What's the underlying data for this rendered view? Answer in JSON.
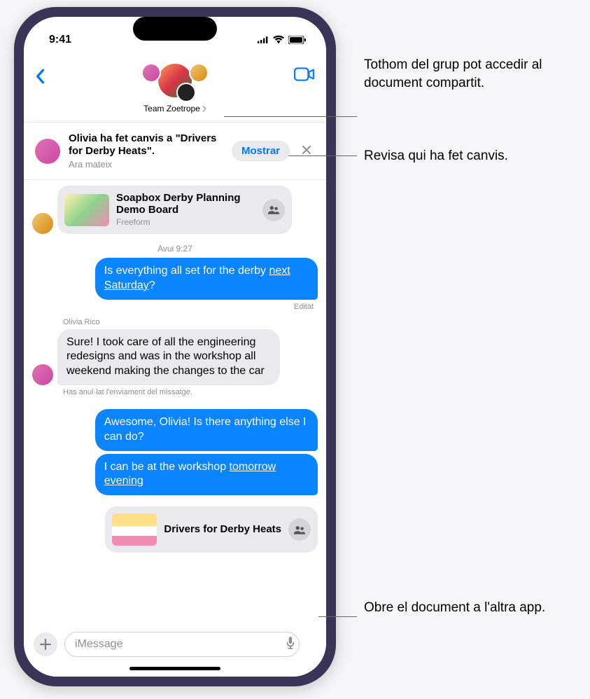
{
  "status_bar": {
    "time": "9:41"
  },
  "header": {
    "team_name": "Team Zoetrope"
  },
  "notification": {
    "title": "Olivia ha fet canvis a \"Drivers for Derby Heats\".",
    "subtitle": "Ara mateix",
    "show_label": "Mostrar"
  },
  "attachment_top": {
    "title": "Soapbox Derby Planning Demo Board",
    "app": "Freeform"
  },
  "timestamp1": "Avui 9:27",
  "msg1_pre": "Is everything all set for the derby ",
  "msg1_underline": "next Saturday",
  "msg1_post": "?",
  "edited_label": "Editat",
  "sender2": "Olivia Rico",
  "msg2": "Sure! I took care of all the engineering redesigns and was in the workshop all weekend making the changes to the car",
  "unsent_note": "Has anul·lat l'enviament del missatge.",
  "msg3": "Awesome, Olivia! Is there anything else I can do?",
  "msg4_pre": "I can be at the workshop ",
  "msg4_underline": "tomorrow evening",
  "attachment_bottom": {
    "title": "Drivers for Derby Heats"
  },
  "input": {
    "placeholder": "iMessage"
  },
  "callouts": {
    "c1": "Tothom del grup pot accedir al document compartit.",
    "c2": "Revisa qui ha fet canvis.",
    "c3": "Obre el document a l'altra app."
  }
}
